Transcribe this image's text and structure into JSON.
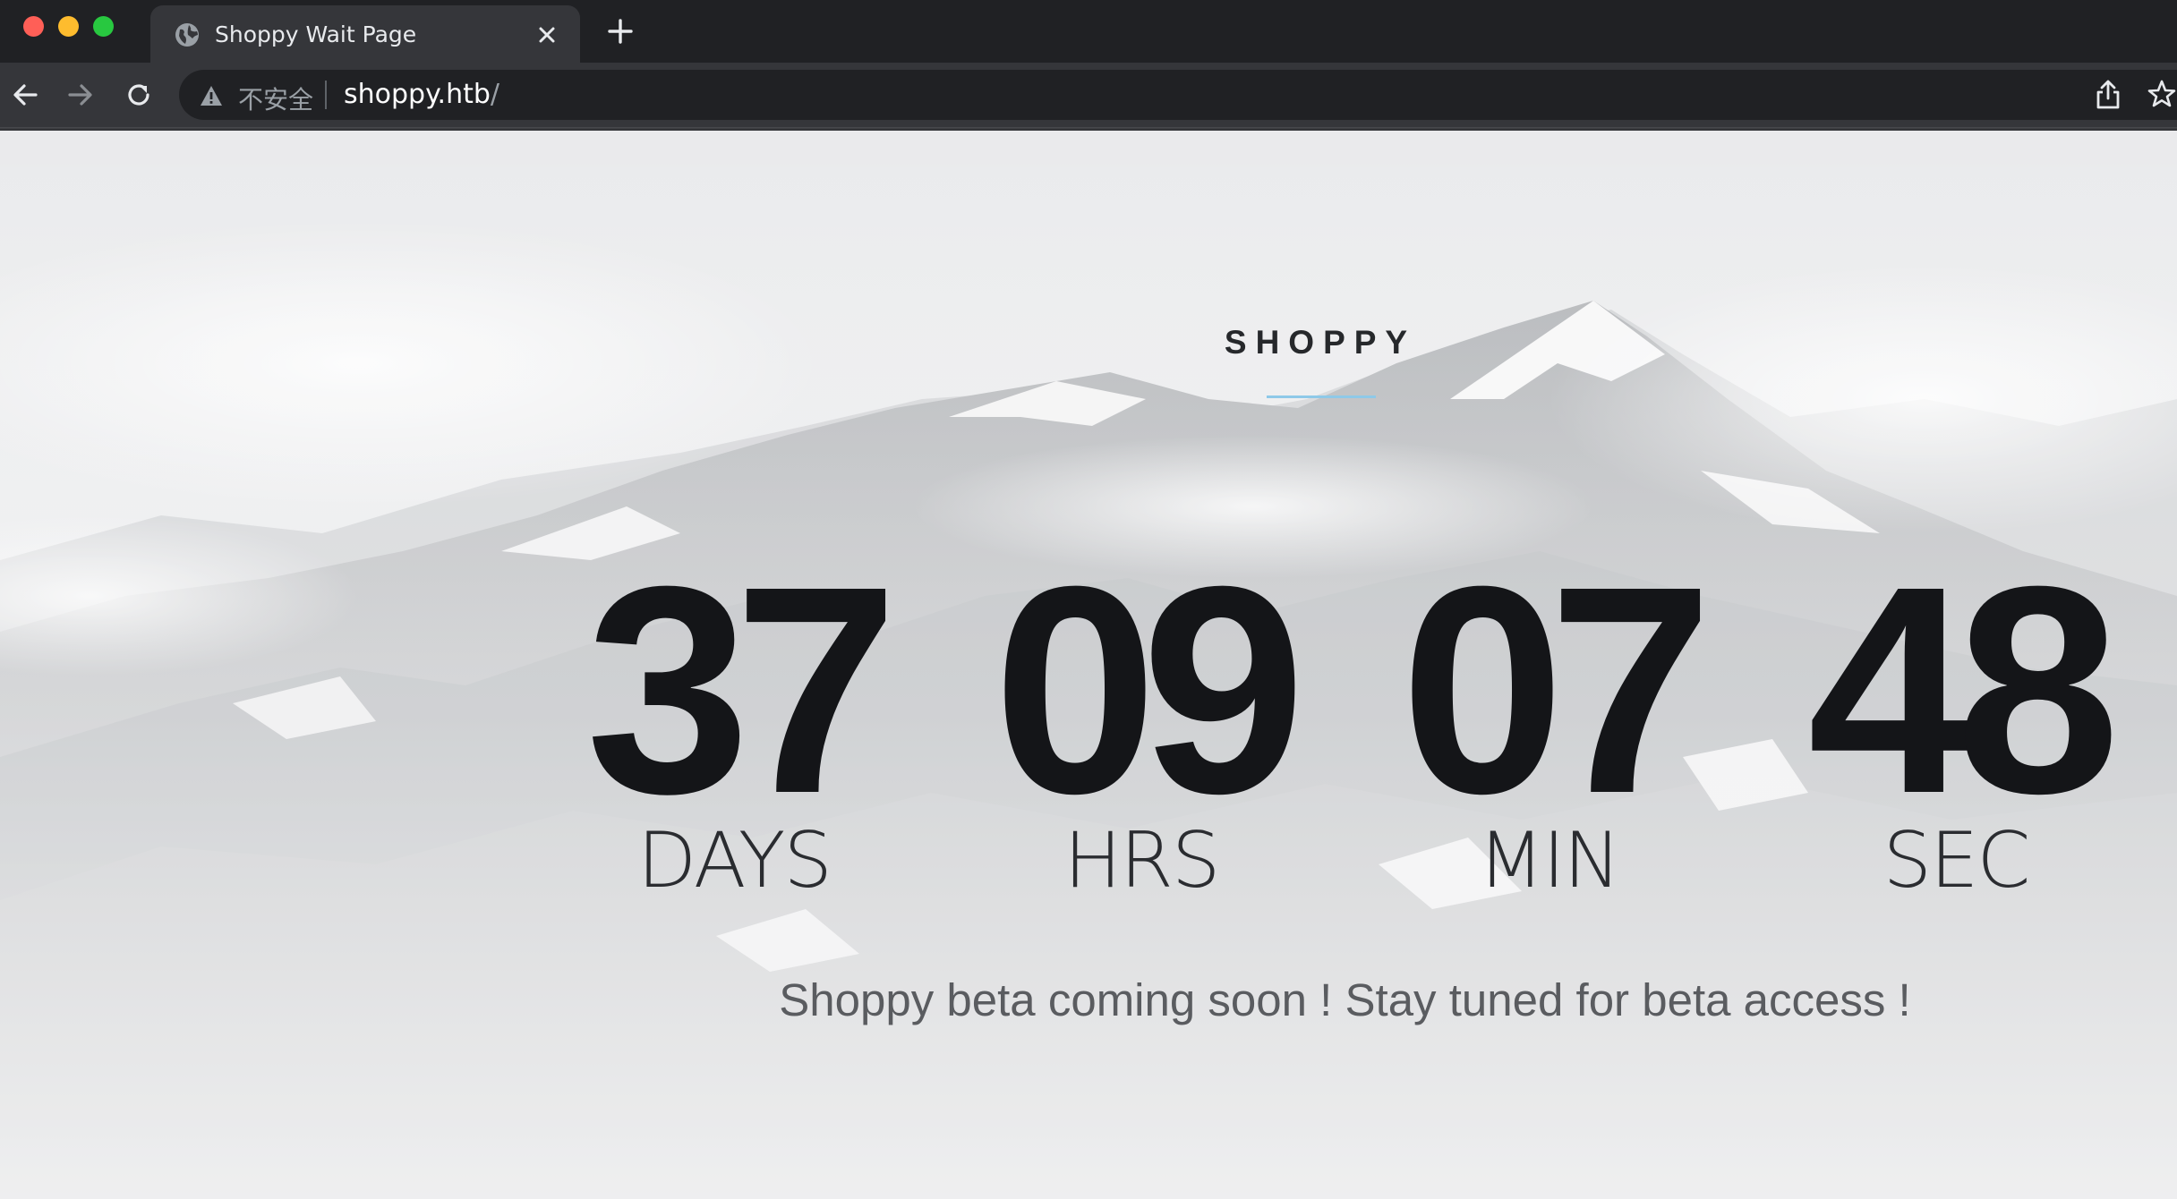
{
  "browser": {
    "tab_title": "Shoppy Wait Page",
    "security_label": "不安全",
    "url_host": "shoppy.htb",
    "url_path": "/"
  },
  "page": {
    "brand": "SHOPPY",
    "countdown": [
      {
        "value": "37",
        "unit": "DAYS"
      },
      {
        "value": "09",
        "unit": "HRS"
      },
      {
        "value": "07",
        "unit": "MIN"
      },
      {
        "value": "48",
        "unit": "SEC"
      }
    ],
    "message": "Shoppy beta coming soon ! Stay tuned for beta access !"
  },
  "colors": {
    "brand_rule": "#8ec9e8",
    "digits": "#141518"
  },
  "icons": [
    "globe-icon",
    "close-icon",
    "plus-icon",
    "back-icon",
    "forward-icon",
    "reload-icon",
    "warning-icon",
    "share-icon",
    "star-icon"
  ]
}
